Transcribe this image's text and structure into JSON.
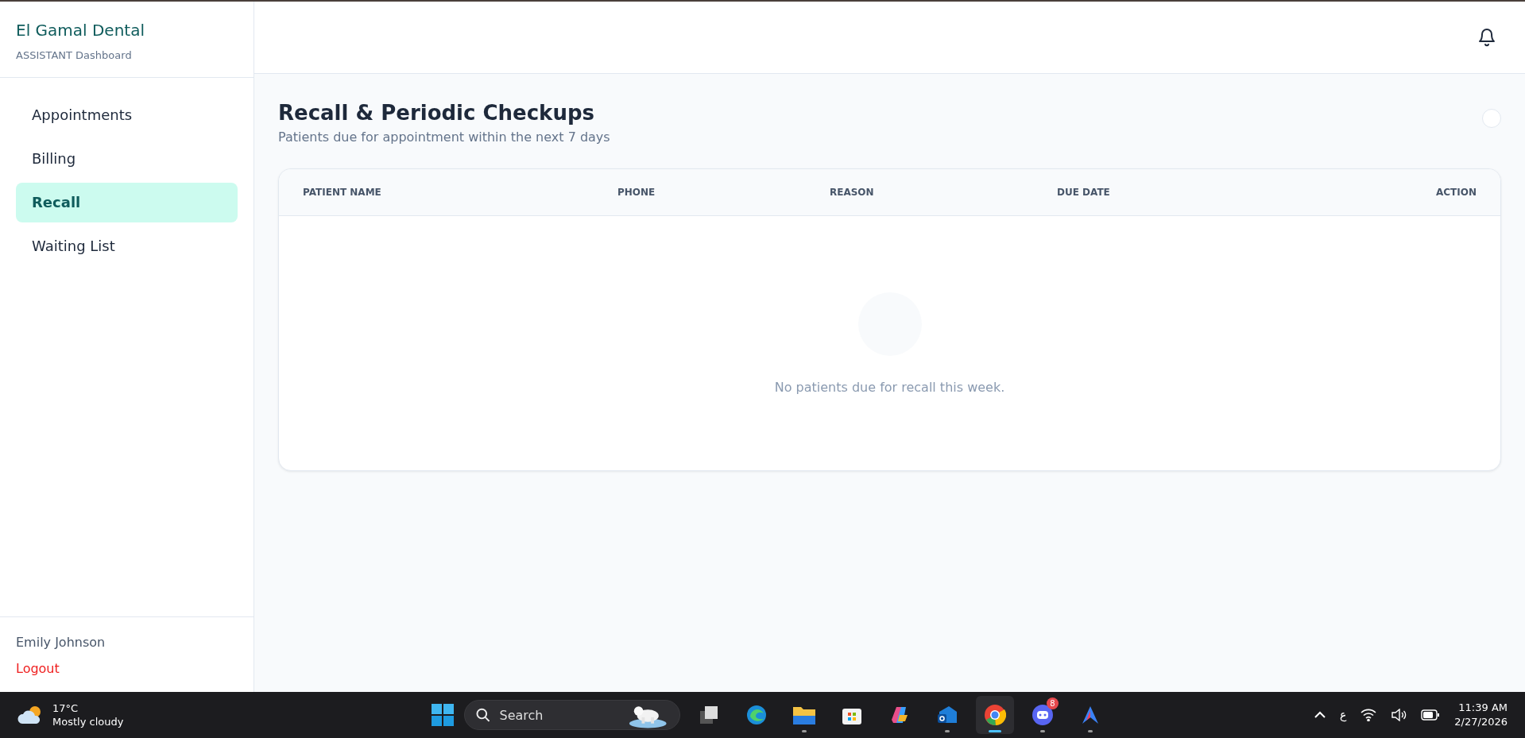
{
  "sidebar": {
    "brand": "El Gamal Dental",
    "subtitle": "ASSISTANT Dashboard",
    "items": [
      {
        "label": "Appointments",
        "selected": false
      },
      {
        "label": "Billing",
        "selected": false
      },
      {
        "label": "Recall",
        "selected": true
      },
      {
        "label": "Waiting List",
        "selected": false
      }
    ],
    "user": "Emily Johnson",
    "logout": "Logout"
  },
  "page": {
    "title": "Recall & Periodic Checkups",
    "subtitle": "Patients due for appointment within the next 7 days"
  },
  "table": {
    "columns": [
      "PATIENT NAME",
      "PHONE",
      "REASON",
      "DUE DATE",
      "ACTION"
    ],
    "empty_message": "No patients due for recall this week."
  },
  "taskbar": {
    "weather": {
      "temperature": "17°C",
      "condition": "Mostly cloudy"
    },
    "search": {
      "placeholder": "Search"
    },
    "apps": [
      {
        "kind": "taskview",
        "running": false,
        "selected": false
      },
      {
        "kind": "edge",
        "running": false,
        "selected": false
      },
      {
        "kind": "files",
        "running": true,
        "selected": false
      },
      {
        "kind": "store",
        "running": false,
        "selected": false
      },
      {
        "kind": "copilot",
        "running": false,
        "selected": false
      },
      {
        "kind": "mail",
        "running": true,
        "selected": false
      },
      {
        "kind": "chrome",
        "running": true,
        "selected": true
      },
      {
        "kind": "chat",
        "running": true,
        "selected": false,
        "badge": "8"
      },
      {
        "kind": "arrow",
        "running": true,
        "selected": false
      }
    ],
    "language": "ع",
    "time": "11:39 AM",
    "date": "2/27/2026"
  }
}
